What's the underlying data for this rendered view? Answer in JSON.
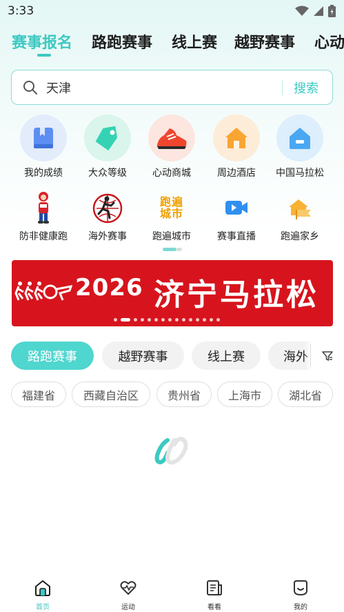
{
  "status_bar": {
    "time": "3:33"
  },
  "top_tabs": [
    {
      "label": "赛事报名"
    },
    {
      "label": "路跑赛事"
    },
    {
      "label": "线上赛"
    },
    {
      "label": "越野赛事"
    },
    {
      "label": "心动"
    }
  ],
  "search": {
    "value": "天津",
    "button_label": "搜索"
  },
  "quick_grid": [
    {
      "label": "我的成绩",
      "icon": "book-icon"
    },
    {
      "label": "大众等级",
      "icon": "tag-icon"
    },
    {
      "label": "心动商城",
      "icon": "shoe-icon"
    },
    {
      "label": "周边酒店",
      "icon": "house-icon"
    },
    {
      "label": "中国马拉松",
      "icon": "home-badge-icon"
    },
    {
      "label": "防非健康跑",
      "icon": "mascot-icon"
    },
    {
      "label": "海外赛事",
      "icon": "run-the-world-icon"
    },
    {
      "label": "跑遍城市",
      "icon": "city-icon"
    },
    {
      "label": "赛事直播",
      "icon": "video-icon"
    },
    {
      "label": "跑遍家乡",
      "icon": "hometown-icon"
    }
  ],
  "city_icon_text": "跑遍城市",
  "banner": {
    "year": "2026",
    "title": "济宁马拉松"
  },
  "categories": [
    {
      "label": "路跑赛事"
    },
    {
      "label": "越野赛事"
    },
    {
      "label": "线上赛"
    },
    {
      "label": "海外"
    }
  ],
  "provinces": [
    {
      "label": "福建省"
    },
    {
      "label": "西藏自治区"
    },
    {
      "label": "贵州省"
    },
    {
      "label": "上海市"
    },
    {
      "label": "湖北省"
    }
  ],
  "bottom_nav": [
    {
      "label": "首页"
    },
    {
      "label": "运动"
    },
    {
      "label": "看看"
    },
    {
      "label": "我的"
    }
  ],
  "colors": {
    "accent": "#3cc9c2",
    "banner_red": "#d7141d"
  }
}
